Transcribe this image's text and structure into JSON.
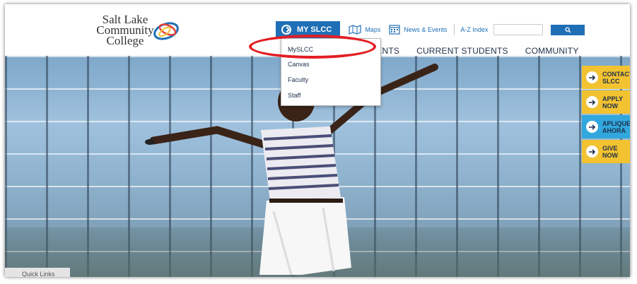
{
  "logo": {
    "line1": "Salt Lake",
    "line2": "Community",
    "line3": "College"
  },
  "topbar": {
    "myslcc_label": "MY SLCC",
    "maps_label": "Maps",
    "news_label": "News & Events",
    "az_label": "A-Z Index",
    "search_placeholder": ""
  },
  "nav": {
    "items": [
      "TUDENTS",
      "CURRENT STUDENTS",
      "COMMUNITY"
    ]
  },
  "dropdown": {
    "items": [
      "MySLCC",
      "Canvas",
      "Faculty",
      "Staff"
    ]
  },
  "cta": [
    {
      "line1": "CONTACT",
      "line2": "SLCC"
    },
    {
      "line1": "APPLY",
      "line2": "NOW"
    },
    {
      "line1": "APLIQUE",
      "line2": "AHORA"
    },
    {
      "line1": "GIVE",
      "line2": "NOW"
    }
  ],
  "quick_links": "Quick Links",
  "colors": {
    "primary_blue": "#1f6fb7",
    "cta_yellow": "#f2c230",
    "cta_blue": "#31a7dd",
    "annotation_red": "#e31e24"
  }
}
